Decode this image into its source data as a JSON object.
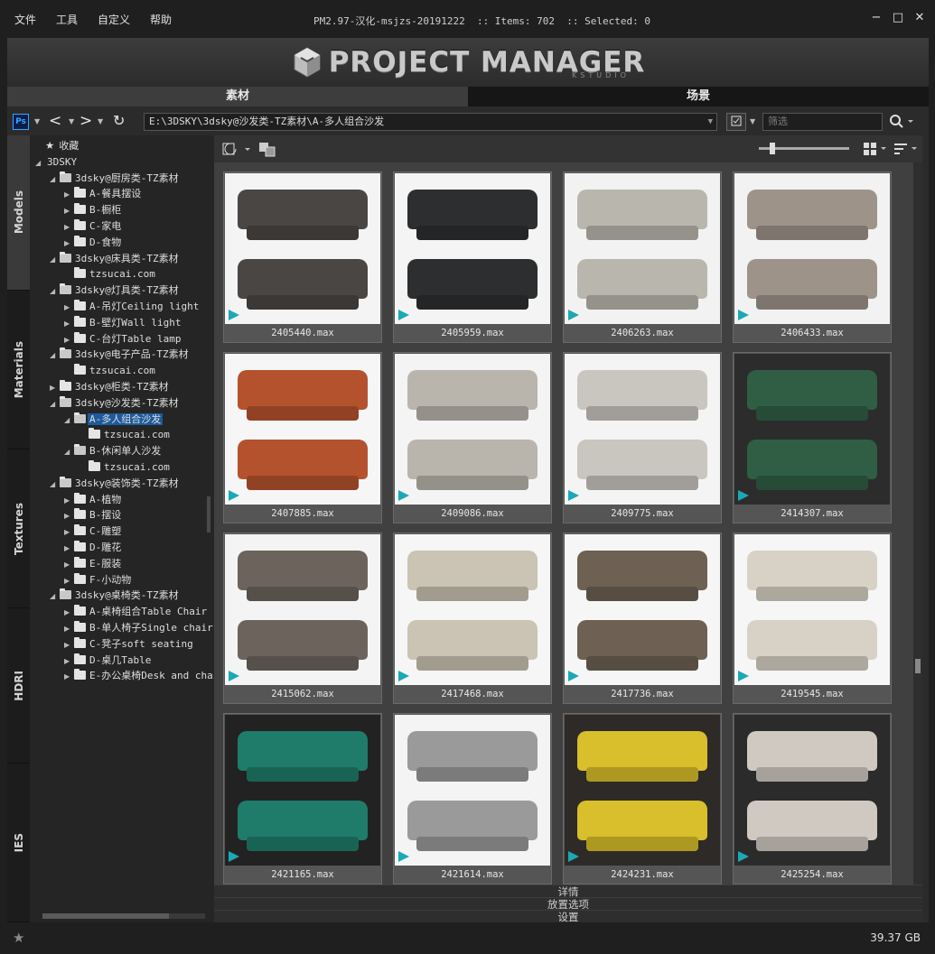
{
  "menu": [
    "文件",
    "工具",
    "自定义",
    "帮助"
  ],
  "title": "PM2.97-汉化-msjzs-20191222  :: Items: 702  :: Selected: 0",
  "window_buttons": {
    "minimize": "−",
    "maximize": "□",
    "close": "✕"
  },
  "banner": {
    "logo_text": "PROJECT MANAGER",
    "logo_sub": "KSTUDIO"
  },
  "tabs": [
    {
      "label": "素材",
      "active": true
    },
    {
      "label": "场景",
      "active": false
    }
  ],
  "toolbar": {
    "ps_label": "Ps",
    "path": "E:\\3DSKY\\3dsky@沙发类-TZ素材\\A-多人组合沙发",
    "filter_placeholder": "筛选"
  },
  "side_tabs": [
    "Models",
    "Materials",
    "Textures",
    "HDRI",
    "IES"
  ],
  "tree": [
    {
      "label": "收藏",
      "depth": 0,
      "arrow": "",
      "icon": "star"
    },
    {
      "label": "3DSKY",
      "depth": 0,
      "arrow": "◢",
      "icon": "none"
    },
    {
      "label": "3dsky@厨房类-TZ素材",
      "depth": 1,
      "arrow": "◢",
      "icon": "folder"
    },
    {
      "label": "A-餐具摆设",
      "depth": 2,
      "arrow": "▶",
      "icon": "folder"
    },
    {
      "label": "B-橱柜",
      "depth": 2,
      "arrow": "▶",
      "icon": "folder"
    },
    {
      "label": "C-家电",
      "depth": 2,
      "arrow": "▶",
      "icon": "folder"
    },
    {
      "label": "D-食物",
      "depth": 2,
      "arrow": "▶",
      "icon": "folder"
    },
    {
      "label": "3dsky@床具类-TZ素材",
      "depth": 1,
      "arrow": "◢",
      "icon": "folder"
    },
    {
      "label": "tzsucai.com",
      "depth": 2,
      "arrow": "",
      "icon": "folder"
    },
    {
      "label": "3dsky@灯具类-TZ素材",
      "depth": 1,
      "arrow": "◢",
      "icon": "folder"
    },
    {
      "label": "A-吊灯Ceiling light",
      "depth": 2,
      "arrow": "▶",
      "icon": "folder"
    },
    {
      "label": "B-壁灯Wall light",
      "depth": 2,
      "arrow": "▶",
      "icon": "folder"
    },
    {
      "label": "C-台灯Table lamp",
      "depth": 2,
      "arrow": "▶",
      "icon": "folder"
    },
    {
      "label": "3dsky@电子产品-TZ素材",
      "depth": 1,
      "arrow": "◢",
      "icon": "folder"
    },
    {
      "label": "tzsucai.com",
      "depth": 2,
      "arrow": "",
      "icon": "folder"
    },
    {
      "label": "3dsky@柜类-TZ素材",
      "depth": 1,
      "arrow": "▶",
      "icon": "folder"
    },
    {
      "label": "3dsky@沙发类-TZ素材",
      "depth": 1,
      "arrow": "◢",
      "icon": "folder"
    },
    {
      "label": "A-多人组合沙发",
      "depth": 2,
      "arrow": "◢",
      "icon": "folder",
      "selected": true
    },
    {
      "label": "tzsucai.com",
      "depth": 3,
      "arrow": "",
      "icon": "folder"
    },
    {
      "label": "B-休闲单人沙发",
      "depth": 2,
      "arrow": "◢",
      "icon": "folder"
    },
    {
      "label": "tzsucai.com",
      "depth": 3,
      "arrow": "",
      "icon": "folder"
    },
    {
      "label": "3dsky@装饰类-TZ素材",
      "depth": 1,
      "arrow": "◢",
      "icon": "folder"
    },
    {
      "label": "A-植物",
      "depth": 2,
      "arrow": "▶",
      "icon": "folder"
    },
    {
      "label": "B-摆设",
      "depth": 2,
      "arrow": "▶",
      "icon": "folder"
    },
    {
      "label": "C-雕塑",
      "depth": 2,
      "arrow": "▶",
      "icon": "folder"
    },
    {
      "label": "D-雕花",
      "depth": 2,
      "arrow": "▶",
      "icon": "folder"
    },
    {
      "label": "E-服装",
      "depth": 2,
      "arrow": "▶",
      "icon": "folder"
    },
    {
      "label": "F-小动物",
      "depth": 2,
      "arrow": "▶",
      "icon": "folder"
    },
    {
      "label": "3dsky@桌椅类-TZ素材",
      "depth": 1,
      "arrow": "◢",
      "icon": "folder"
    },
    {
      "label": "A-桌椅组合Table Chair",
      "depth": 2,
      "arrow": "▶",
      "icon": "folder"
    },
    {
      "label": "B-单人椅子Single chair",
      "depth": 2,
      "arrow": "▶",
      "icon": "folder"
    },
    {
      "label": "C-凳子soft seating",
      "depth": 2,
      "arrow": "▶",
      "icon": "folder"
    },
    {
      "label": "D-桌几Table",
      "depth": 2,
      "arrow": "▶",
      "icon": "folder"
    },
    {
      "label": "E-办公桌椅Desk and chair",
      "depth": 2,
      "arrow": "▶",
      "icon": "folder"
    }
  ],
  "items": [
    {
      "file": "2405440.max",
      "bg": "#f4f4f4",
      "sofa": "#4a4644"
    },
    {
      "file": "2405959.max",
      "bg": "#f4f4f4",
      "sofa": "#2d2e30"
    },
    {
      "file": "2406263.max",
      "bg": "#f2f2f2",
      "sofa": "#b9b6ad"
    },
    {
      "file": "2406433.max",
      "bg": "#f2f2f2",
      "sofa": "#9d9389"
    },
    {
      "file": "2407885.max",
      "bg": "#f6f6f6",
      "sofa": "#b5522e"
    },
    {
      "file": "2409086.max",
      "bg": "#f4f4f4",
      "sofa": "#b9b5ac"
    },
    {
      "file": "2409775.max",
      "bg": "#f4f4f4",
      "sofa": "#c9c6bf"
    },
    {
      "file": "2414307.max",
      "bg": "#2c2c2c",
      "sofa": "#2f5e45"
    },
    {
      "file": "2415062.max",
      "bg": "#f4f4f4",
      "sofa": "#6c645c"
    },
    {
      "file": "2417468.max",
      "bg": "#f6f6f6",
      "sofa": "#cbc3b3"
    },
    {
      "file": "2417736.max",
      "bg": "#f6f6f6",
      "sofa": "#6e6052"
    },
    {
      "file": "2419545.max",
      "bg": "#f6f6f6",
      "sofa": "#d8d2c6"
    },
    {
      "file": "2421165.max",
      "bg": "#222222",
      "sofa": "#1f7c6a"
    },
    {
      "file": "2421614.max",
      "bg": "#f4f4f4",
      "sofa": "#9a9a9a"
    },
    {
      "file": "2424231.max",
      "bg": "#2e2a28",
      "sofa": "#d8bf2b"
    },
    {
      "file": "2425254.max",
      "bg": "#2b2b2b",
      "sofa": "#cfc9c1"
    }
  ],
  "bottom_panels": [
    "详情",
    "放置选项",
    "设置"
  ],
  "status": {
    "disk_free": "39.37 GB"
  }
}
